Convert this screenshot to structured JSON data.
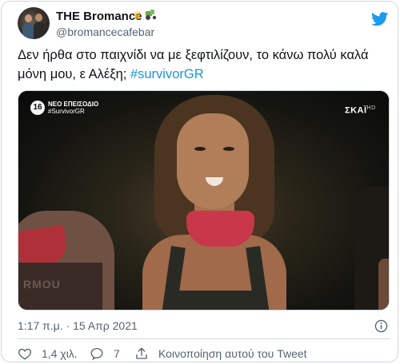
{
  "author": {
    "display_name": "THE Bromance",
    "handle": "@bromancecafebar",
    "name_emojis": [
      "crown-emoji",
      "tractor-emoji"
    ]
  },
  "tweet": {
    "text": "Δεν ήρθα στο παιχνίδι να με ξεφτιλίζουν, το κάνω πολύ καλά μόνη μου, ε Αλέξη; ",
    "hashtag": "#survivorGR",
    "timestamp": "1:17 π.μ. · 15 Απρ 2021"
  },
  "media": {
    "badge_line1": "ΝΕΟ ΕΠΕΙΣΟΔΙΟ",
    "badge_line2": "#SurvivorGR",
    "channel": "ΣΚΑΪ",
    "channel_hd": "HD",
    "shirt_logo": "RMOU"
  },
  "actions": {
    "likes": "1,4 χιλ.",
    "replies": "7",
    "share_label": "Κοινοποίηση αυτού του Tweet"
  },
  "colors": {
    "accent": "#1d9bf0",
    "hashtag": "#1b95e0",
    "muted_text": "#536471",
    "border": "#cfd9de"
  },
  "icons": [
    "twitter-logo-icon",
    "info-icon",
    "heart-icon",
    "reply-icon",
    "share-icon"
  ]
}
